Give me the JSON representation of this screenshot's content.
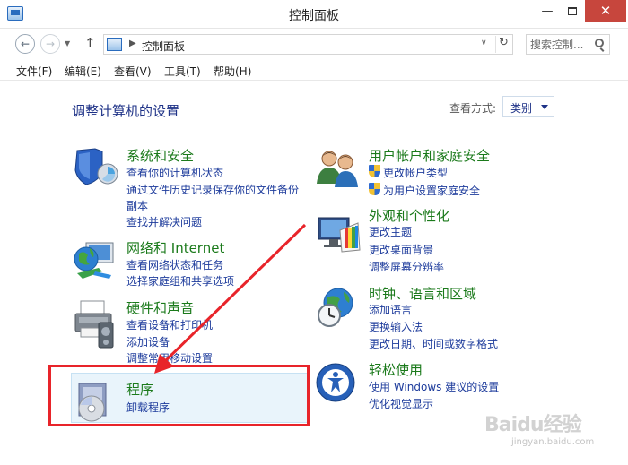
{
  "window": {
    "title": "控制面板",
    "min_glyph": "—",
    "close_glyph": "✕"
  },
  "address": {
    "back_glyph": "←",
    "forward_glyph": "→",
    "recent_glyph": "▼",
    "up_glyph": "↑",
    "crumb_arrow": "▶",
    "crumb": "控制面板",
    "dropdown_glyph": "∨",
    "refresh_glyph": "↻",
    "search_placeholder": "搜索控制..."
  },
  "menu": [
    "文件(F)",
    "编辑(E)",
    "查看(V)",
    "工具(T)",
    "帮助(H)"
  ],
  "page": {
    "heading": "调整计算机的设置",
    "view_by_label": "查看方式:",
    "view_by_value": "类别"
  },
  "categories": {
    "security": {
      "title": "系统和安全",
      "links": [
        "查看你的计算机状态",
        "通过文件历史记录保存你的文件备份",
        "副本",
        "查找并解决问题"
      ]
    },
    "network": {
      "title": "网络和 Internet",
      "links": [
        "查看网络状态和任务",
        "选择家庭组和共享选项"
      ]
    },
    "hardware": {
      "title": "硬件和声音",
      "links": [
        "查看设备和打印机",
        "添加设备",
        "调整常用移动设置"
      ]
    },
    "programs": {
      "title": "程序",
      "links": [
        "卸载程序"
      ]
    },
    "users": {
      "title": "用户帐户和家庭安全",
      "links": [
        "更改帐户类型",
        "为用户设置家庭安全"
      ]
    },
    "appearance": {
      "title": "外观和个性化",
      "links": [
        "更改主题",
        "更改桌面背景",
        "调整屏幕分辨率"
      ]
    },
    "clock": {
      "title": "时钟、语言和区域",
      "links": [
        "添加语言",
        "更换输入法",
        "更改日期、时间或数字格式"
      ]
    },
    "ease": {
      "title": "轻松使用",
      "links": [
        "使用 Windows 建议的设置",
        "优化视觉显示"
      ]
    }
  },
  "watermark": {
    "main": "Baidu经验",
    "sub": "jingyan.baidu.com"
  },
  "colors": {
    "category_title": "#1b7a1b",
    "link": "#1e3c9c",
    "heading": "#1e3287",
    "annotation_red": "#e8242a",
    "close_button": "#c7463d"
  }
}
